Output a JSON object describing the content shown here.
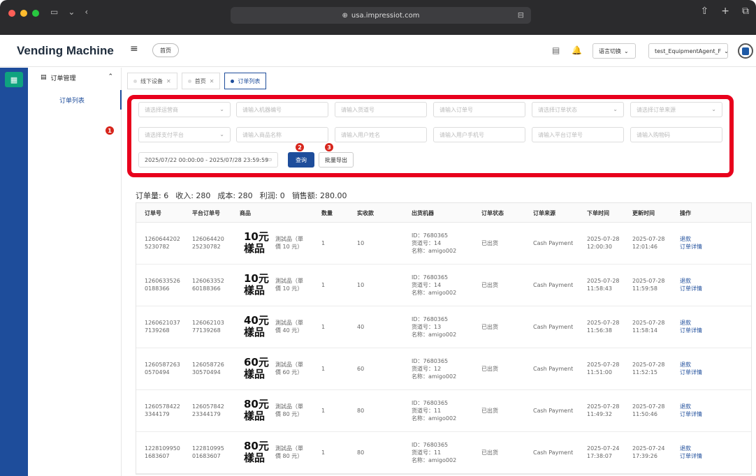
{
  "browser": {
    "url": "usa.impressiot.com"
  },
  "app": {
    "brand": "Vending Machine",
    "home_chip": "首页",
    "language_switch": "语言切换",
    "account": "test_EquipmentAgent_F"
  },
  "sidebar": {
    "group_label": "订单管理",
    "item_label": "订单列表"
  },
  "tabs": [
    {
      "label": "线下设备"
    },
    {
      "label": "首页"
    },
    {
      "label": "订单列表"
    }
  ],
  "filters": {
    "row1": [
      "请选择运营商",
      "请输入机器编号",
      "请输入货道号",
      "请输入订单号",
      "请选择订单状态",
      "请选择订单来源"
    ],
    "row2": [
      "请选择支付平台",
      "请输入商品名称",
      "请输入用户姓名",
      "请输入用户手机号",
      "请输入平台订单号",
      "请输入购物码"
    ],
    "date_range": "2025/07/22 00:00:00 - 2025/07/28 23:59:59",
    "query_button": "查询",
    "export_button": "批量导出",
    "badges": [
      "1",
      "2",
      "3"
    ]
  },
  "summary": {
    "order_count": "订单量: 6",
    "income": "收入: 280",
    "cost": "成本: 280",
    "profit": "利润: 0",
    "sales": "销售额: 280.00"
  },
  "table": {
    "columns": [
      "订单号",
      "平台订单号",
      "商品",
      "数量",
      "实收款",
      "出货机器",
      "订单状态",
      "订单来源",
      "下单时间",
      "更新时间",
      "操作"
    ],
    "rows": [
      {
        "order_no": [
          "1260644202",
          "5230782"
        ],
        "platform_no": [
          "126064420",
          "25230782"
        ],
        "product_big": [
          "10元",
          "樣品"
        ],
        "product_desc": [
          "測試品（單",
          "價 10 元）"
        ],
        "qty": "1",
        "paid": "10",
        "machine": [
          "ID：7680365",
          "货道号：14",
          "名称：amigo002"
        ],
        "status": "已出货",
        "source": "Cash Payment",
        "created": [
          "2025-07-28",
          "12:00:30"
        ],
        "updated": [
          "2025-07-28",
          "12:01:46"
        ],
        "actions": [
          "退款",
          "订单详情"
        ]
      },
      {
        "order_no": [
          "1260633526",
          "0188366"
        ],
        "platform_no": [
          "126063352",
          "60188366"
        ],
        "product_big": [
          "10元",
          "樣品"
        ],
        "product_desc": [
          "測試品（單",
          "價 10 元）"
        ],
        "qty": "1",
        "paid": "10",
        "machine": [
          "ID：7680365",
          "货道号：14",
          "名称：amigo002"
        ],
        "status": "已出货",
        "source": "Cash Payment",
        "created": [
          "2025-07-28",
          "11:58:43"
        ],
        "updated": [
          "2025-07-28",
          "11:59:58"
        ],
        "actions": [
          "退款",
          "订单详情"
        ]
      },
      {
        "order_no": [
          "1260621037",
          "7139268"
        ],
        "platform_no": [
          "126062103",
          "77139268"
        ],
        "product_big": [
          "40元",
          "樣品"
        ],
        "product_desc": [
          "測試品（單",
          "價 40 元）"
        ],
        "qty": "1",
        "paid": "40",
        "machine": [
          "ID：7680365",
          "货道号：13",
          "名称：amigo002"
        ],
        "status": "已出货",
        "source": "Cash Payment",
        "created": [
          "2025-07-28",
          "11:56:38"
        ],
        "updated": [
          "2025-07-28",
          "11:58:14"
        ],
        "actions": [
          "退款",
          "订单详情"
        ]
      },
      {
        "order_no": [
          "1260587263",
          "0570494"
        ],
        "platform_no": [
          "126058726",
          "30570494"
        ],
        "product_big": [
          "60元",
          "樣品"
        ],
        "product_desc": [
          "測試品（單",
          "價 60 元）"
        ],
        "qty": "1",
        "paid": "60",
        "machine": [
          "ID：7680365",
          "货道号：12",
          "名称：amigo002"
        ],
        "status": "已出货",
        "source": "Cash Payment",
        "created": [
          "2025-07-28",
          "11:51:00"
        ],
        "updated": [
          "2025-07-28",
          "11:52:15"
        ],
        "actions": [
          "退款",
          "订单详情"
        ]
      },
      {
        "order_no": [
          "1260578422",
          "3344179"
        ],
        "platform_no": [
          "126057842",
          "23344179"
        ],
        "product_big": [
          "80元",
          "樣品"
        ],
        "product_desc": [
          "測試品（單",
          "價 80 元）"
        ],
        "qty": "1",
        "paid": "80",
        "machine": [
          "ID：7680365",
          "货道号：11",
          "名称：amigo002"
        ],
        "status": "已出货",
        "source": "Cash Payment",
        "created": [
          "2025-07-28",
          "11:49:32"
        ],
        "updated": [
          "2025-07-28",
          "11:50:46"
        ],
        "actions": [
          "退款",
          "订单详情"
        ]
      },
      {
        "order_no": [
          "1228109950",
          "1683607"
        ],
        "platform_no": [
          "122810995",
          "01683607"
        ],
        "product_big": [
          "80元",
          "樣品"
        ],
        "product_desc": [
          "測試品（單",
          "價 80 元）"
        ],
        "qty": "1",
        "paid": "80",
        "machine": [
          "ID：7680365",
          "货道号：11",
          "名称：amigo002"
        ],
        "status": "已出货",
        "source": "Cash Payment",
        "created": [
          "2025-07-24",
          "17:38:07"
        ],
        "updated": [
          "2025-07-24",
          "17:39:26"
        ],
        "actions": [
          "退款",
          "订单详情"
        ]
      }
    ]
  },
  "colors": {
    "brand_blue": "#1e4d9b",
    "highlight_red": "#e8001c",
    "rail_green": "#0fa37f"
  }
}
